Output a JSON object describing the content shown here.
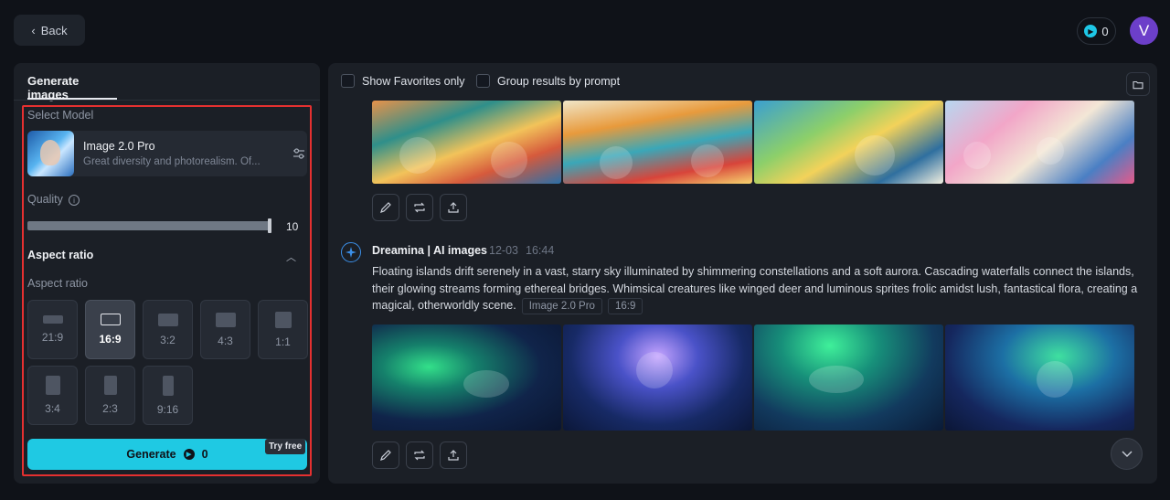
{
  "header": {
    "back_label": "Back",
    "credits": "0",
    "avatar_letter": "V"
  },
  "left_panel": {
    "tab_label": "Generate images",
    "model_section_label": "Select Model",
    "model": {
      "name": "Image 2.0 Pro",
      "description": "Great diversity and photorealism. Of..."
    },
    "quality_label": "Quality",
    "quality_value": "10",
    "quality_fraction": 1.0,
    "aspect_header": "Aspect ratio",
    "aspect_sublabel": "Aspect ratio",
    "aspect_ratios": [
      "21:9",
      "16:9",
      "3:2",
      "4:3",
      "1:1",
      "3:4",
      "2:3",
      "9:16"
    ],
    "selected_ratio": "16:9",
    "generate_label": "Generate",
    "generate_cost": "0",
    "try_free_label": "Try free"
  },
  "right_panel": {
    "show_favorites_label": "Show Favorites only",
    "group_results_label": "Group results by prompt",
    "entry": {
      "author": "Dreamina | AI images",
      "date": "12-03",
      "time": "16:44",
      "prompt": "Floating islands drift serenely in a vast, starry sky illuminated by shimmering constellations and a soft aurora. Cascading waterfalls connect the islands, their glowing streams forming ethereal bridges. Whimsical creatures like winged deer and luminous sprites frolic amidst lush, fantastical flora, creating a magical, otherworldly scene.",
      "model_tag": "Image 2.0 Pro",
      "ratio_tag": "16:9"
    }
  },
  "colors": {
    "accent": "#1fc9e3",
    "highlight_border": "#e53030",
    "avatar": "#6c3fc9"
  }
}
